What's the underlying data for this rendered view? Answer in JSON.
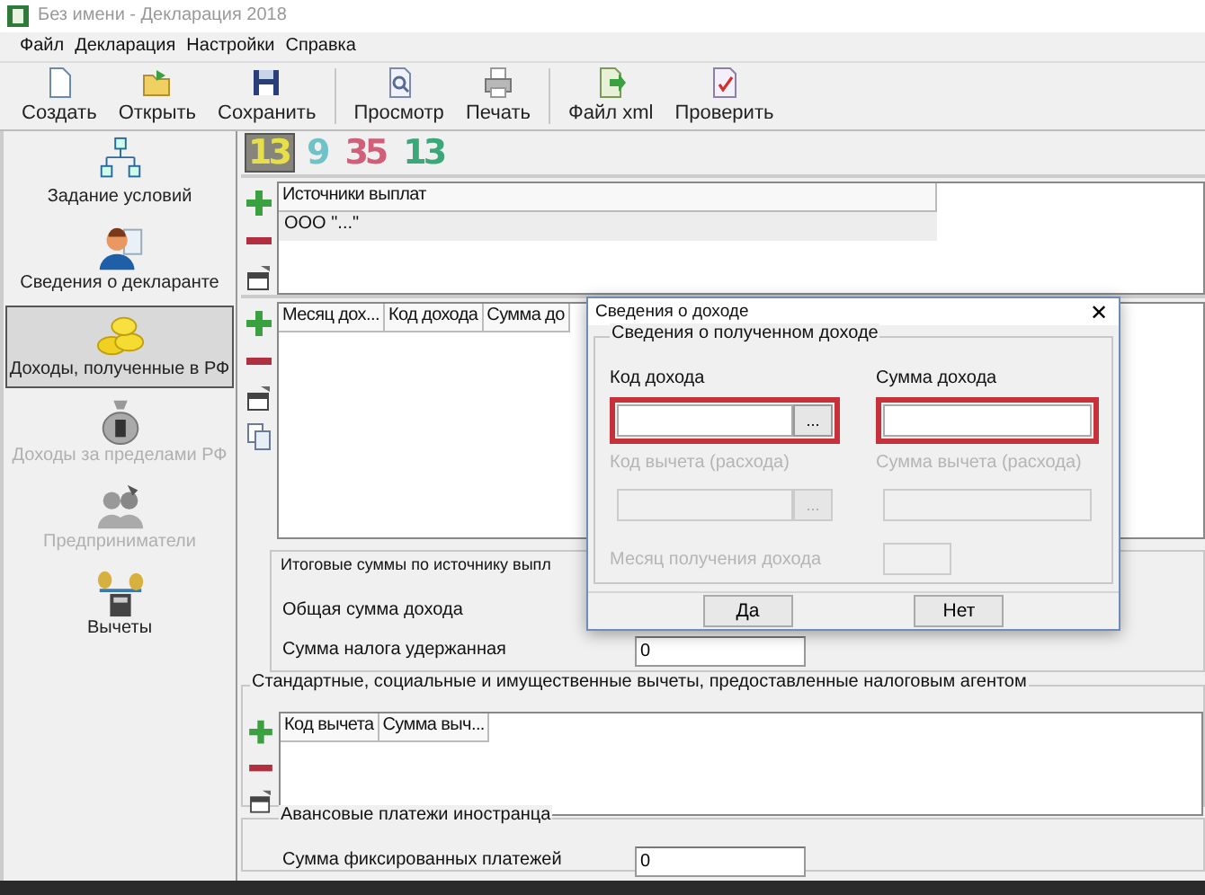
{
  "window": {
    "title": "Без имени - Декларация 2018"
  },
  "menu": [
    "Файл",
    "Декларация",
    "Настройки",
    "Справка"
  ],
  "toolbar": [
    [
      {
        "label": "Создать"
      },
      {
        "label": "Открыть"
      },
      {
        "label": "Сохранить"
      }
    ],
    [
      {
        "label": "Просмотр"
      },
      {
        "label": "Печать"
      }
    ],
    [
      {
        "label": "Файл xml"
      },
      {
        "label": "Проверить"
      }
    ]
  ],
  "sidebar": [
    {
      "label": "Задание условий",
      "selected": false,
      "disabled": false
    },
    {
      "label": "Сведения о декларанте",
      "selected": false,
      "disabled": false
    },
    {
      "label": "Доходы, полученные в РФ",
      "selected": true,
      "disabled": false
    },
    {
      "label": "Доходы за пределами РФ",
      "selected": false,
      "disabled": true
    },
    {
      "label": "Предприниматели",
      "selected": false,
      "disabled": true
    },
    {
      "label": "Вычеты",
      "selected": false,
      "disabled": false
    }
  ],
  "rates": [
    {
      "label": "13",
      "selected": true,
      "color": "#e6df4a"
    },
    {
      "label": "9",
      "selected": false,
      "color": "#6fc3c8"
    },
    {
      "label": "35",
      "selected": false,
      "color": "#d0607a"
    },
    {
      "label": "13",
      "selected": false,
      "color": "#3aa878"
    }
  ],
  "sources": {
    "columns": [
      "Источники выплат"
    ],
    "rows": [
      [
        "ООО \"...\""
      ]
    ]
  },
  "incomes": {
    "columns": [
      "Месяц дох...",
      "Код дохода",
      "Сумма до"
    ]
  },
  "totals": {
    "title": "Итоговые суммы по источнику выпл",
    "fields": [
      {
        "label": "Общая сумма дохода"
      },
      {
        "label": "Сумма налога удержанная",
        "value": "0"
      }
    ]
  },
  "deductions": {
    "title": "Стандартные, социальные и имущественные вычеты, предоставленные налоговым агентом",
    "columns": [
      "Код вычета",
      "Сумма выч..."
    ]
  },
  "advance": {
    "title": "Авансовые платежи иностранца",
    "fields": [
      {
        "label": "Сумма фиксированных платежей",
        "value": "0"
      }
    ]
  },
  "dialog": {
    "title": "Сведения о доходе",
    "close": "✕",
    "group": "Сведения о полученном доходе",
    "fields": [
      {
        "label": "Код дохода",
        "kind": "wide",
        "browse": "...",
        "disabled": false,
        "highlighted": true
      },
      {
        "label": "Сумма дохода",
        "kind": "wide",
        "disabled": false,
        "highlighted": true
      },
      {
        "label": "Код вычета (расхода)",
        "kind": "wide",
        "browse": "...",
        "disabled": true,
        "highlighted": false
      },
      {
        "label": "Сумма вычета (расхода)",
        "kind": "wide",
        "disabled": true,
        "highlighted": false
      },
      {
        "label": "Месяц получения дохода",
        "kind": "short",
        "disabled": true,
        "highlighted": false
      }
    ],
    "buttons": [
      "Да",
      "Нет"
    ]
  }
}
